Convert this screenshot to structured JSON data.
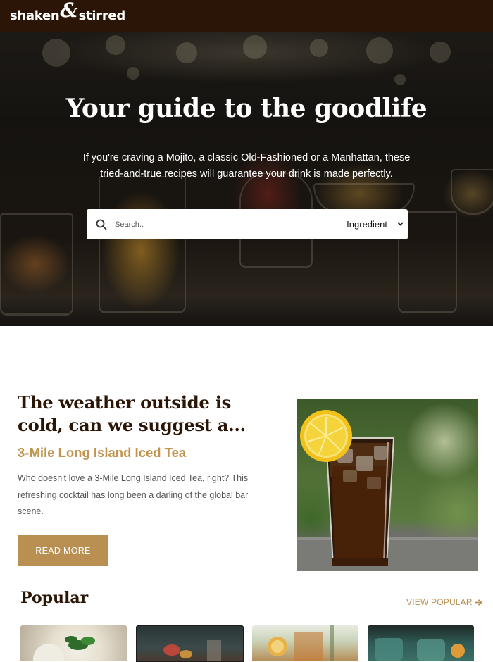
{
  "header": {
    "logo_left": "shaken",
    "logo_amp": "&",
    "logo_right": "stirred"
  },
  "hero": {
    "title": "Your guide to the goodlife",
    "subtitle": "If you're craving a Mojito, a classic Old-Fashioned or a Manhattan, these tried-and-true recipes will guarantee your drink is made perfectly.",
    "search": {
      "placeholder": "Search..",
      "value": "",
      "filter_selected": "Ingredient"
    }
  },
  "feature": {
    "heading": "The weather outside is cold, can we suggest a...",
    "drink_name": "3-Mile Long Island Iced Tea",
    "description": "Who doesn't love a 3-Mile Long Island Iced Tea, right? This refreshing cocktail has long been a darling of the global bar scene.",
    "button_label": "READ MORE"
  },
  "popular": {
    "heading": "Popular",
    "link_label": "VIEW POPULAR",
    "cards": [
      {
        "name": "popular-card-1"
      },
      {
        "name": "popular-card-2"
      },
      {
        "name": "popular-card-3"
      },
      {
        "name": "popular-card-4"
      }
    ]
  },
  "colors": {
    "header_bg": "#2a1506",
    "accent": "#b98f52",
    "heading": "#2a1506"
  },
  "icons": {
    "search": "search-icon",
    "select": "chevron-down-icon",
    "arrow": "arrow-right-icon"
  }
}
